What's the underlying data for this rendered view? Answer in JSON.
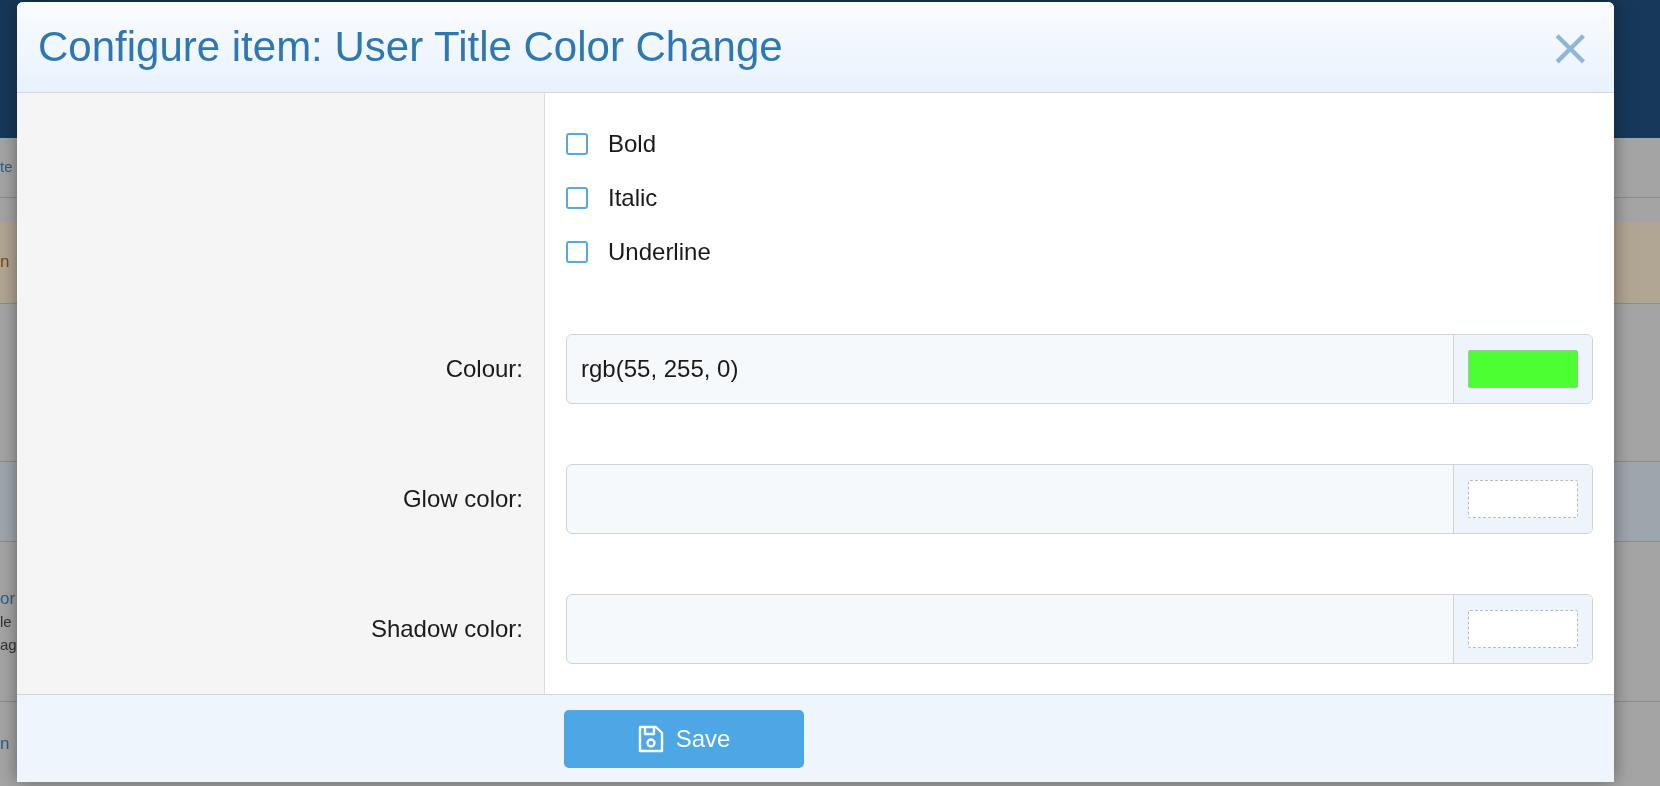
{
  "background": {
    "fragments": [
      {
        "text": "te",
        "kind": "link"
      },
      {
        "text": "n",
        "kind": "notice"
      },
      {
        "text": "or",
        "kind": "heading"
      },
      {
        "text": "le",
        "kind": "body"
      },
      {
        "text": "ag",
        "kind": "body"
      },
      {
        "text": "n",
        "kind": "heading"
      }
    ]
  },
  "dialog": {
    "title": "Configure item: User Title Color Change",
    "close": "×",
    "options": [
      {
        "label": "Bold",
        "checked": false
      },
      {
        "label": "Italic",
        "checked": false
      },
      {
        "label": "Underline",
        "checked": false
      }
    ],
    "color_fields": [
      {
        "label": "Colour:",
        "value": "rgb(55, 255, 0)",
        "color": "#4cff33"
      },
      {
        "label": "Glow color:"
      },
      {
        "label": "Shadow color:"
      }
    ],
    "save_button": "Save"
  }
}
